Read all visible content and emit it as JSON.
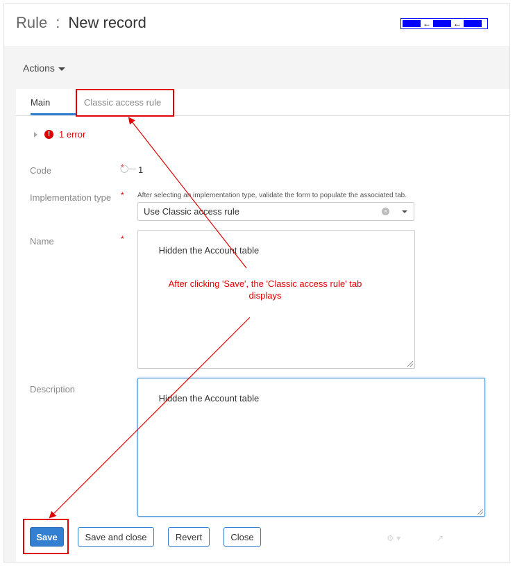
{
  "header": {
    "entity": "Rule",
    "separator": ":",
    "record_title": "New record"
  },
  "actions": {
    "label": "Actions"
  },
  "tabs": [
    {
      "label": "Main"
    },
    {
      "label": "Classic access rule"
    }
  ],
  "errors": {
    "label": "1 error",
    "icon": "!"
  },
  "form": {
    "code": {
      "label": "Code",
      "value": "1"
    },
    "implementation_type": {
      "label": "Implementation type",
      "hint": "After selecting an implementation type, validate the form to populate the associated tab.",
      "value": "Use Classic access rule"
    },
    "name": {
      "label": "Name",
      "value": "Hidden the Account table"
    },
    "description": {
      "label": "Description",
      "value": "Hidden the Account table"
    },
    "required_mark": "*"
  },
  "footer": {
    "save": "Save",
    "save_close": "Save and close",
    "revert": "Revert",
    "close": "Close"
  },
  "annotation": {
    "text": "After clicking 'Save', the 'Classic access rule' tab displays"
  },
  "colors": {
    "accent": "#3380d3",
    "error": "#dd0000",
    "annotation": "#e00000",
    "logo": "#0000ff"
  }
}
